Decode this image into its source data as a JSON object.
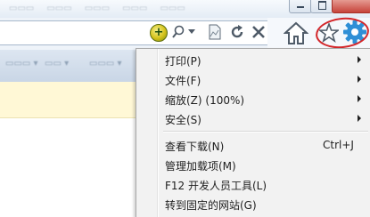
{
  "menu": {
    "items": [
      {
        "label": "打印(P)",
        "has_submenu": true
      },
      {
        "label": "文件(F)",
        "has_submenu": true
      },
      {
        "label": "缩放(Z) (100%)",
        "has_submenu": true
      },
      {
        "label": "安全(S)",
        "has_submenu": true
      },
      {
        "label": "查看下载(N)",
        "shortcut": "Ctrl+J"
      },
      {
        "label": "管理加载项(M)"
      },
      {
        "label": "F12 开发人员工具(L)"
      },
      {
        "label": "转到固定的网站(G)"
      }
    ]
  },
  "icons": {
    "compat": "compatibility-view-icon",
    "search": "search-icon",
    "refresh": "refresh-icon",
    "stop": "stop-icon",
    "home": "home-icon",
    "favorites": "star-icon",
    "tools": "gear-icon"
  },
  "colors": {
    "highlight_ring": "#d3262a",
    "gear_blue": "#2f8fd6",
    "infobar": "#fff8d6"
  }
}
